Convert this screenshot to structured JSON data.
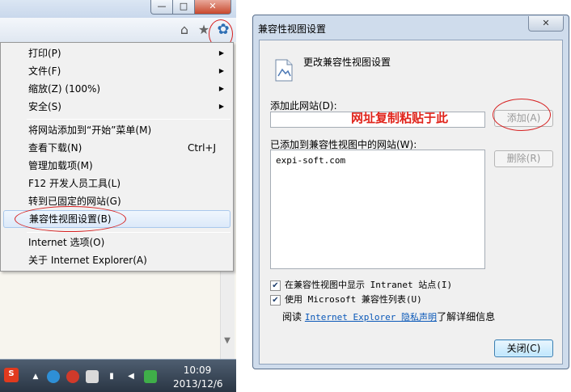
{
  "ie": {
    "window_buttons": {
      "minimize": "—",
      "maximize": "□",
      "close": "✕"
    },
    "icons": {
      "home": "home-icon",
      "favorites": "star-icon",
      "tools": "gear-icon"
    },
    "menu": {
      "items": [
        {
          "label": "打印(P)",
          "submenu": true
        },
        {
          "label": "文件(F)",
          "submenu": true
        },
        {
          "label": "缩放(Z) (100%)",
          "submenu": true
        },
        {
          "label": "安全(S)",
          "submenu": true
        },
        {
          "label": "将网站添加到“开始”菜单(M)"
        },
        {
          "label": "查看下载(N)",
          "shortcut": "Ctrl+J"
        },
        {
          "label": "管理加载项(M)"
        },
        {
          "label": "F12 开发人员工具(L)"
        },
        {
          "label": "转到已固定的网站(G)"
        },
        {
          "label": "兼容性视图设置(B)",
          "highlighted": true
        },
        {
          "label": "Internet 选项(O)"
        },
        {
          "label": "关于 Internet Explorer(A)"
        }
      ]
    },
    "taskbar": {
      "time": "10:09",
      "date": "2013/12/6"
    }
  },
  "dialog": {
    "title": "兼容性视图设置",
    "close": "✕",
    "heading": "更改兼容性视图设置",
    "add_label": "添加此网站(D):",
    "add_value": "",
    "paste_hint": "网址复制粘贴于此",
    "add_button": "添加(A)",
    "list_label": "已添加到兼容性视图中的网站(W):",
    "sites": [
      "expi-soft.com"
    ],
    "remove_button": "删除(R)",
    "checkbox_intranet": "在兼容性视图中显示 Intranet 站点(I)",
    "checkbox_mslist": "使用 Microsoft 兼容性列表(U)",
    "read_prefix": "阅读",
    "privacy_link": "Internet Explorer 隐私声明",
    "read_suffix": "了解详细信息",
    "close_button": "关闭(C)",
    "intranet_checked": true,
    "mslist_checked": true
  },
  "colors": {
    "annotation_red": "#e0241b",
    "link_blue": "#0a58b8"
  }
}
